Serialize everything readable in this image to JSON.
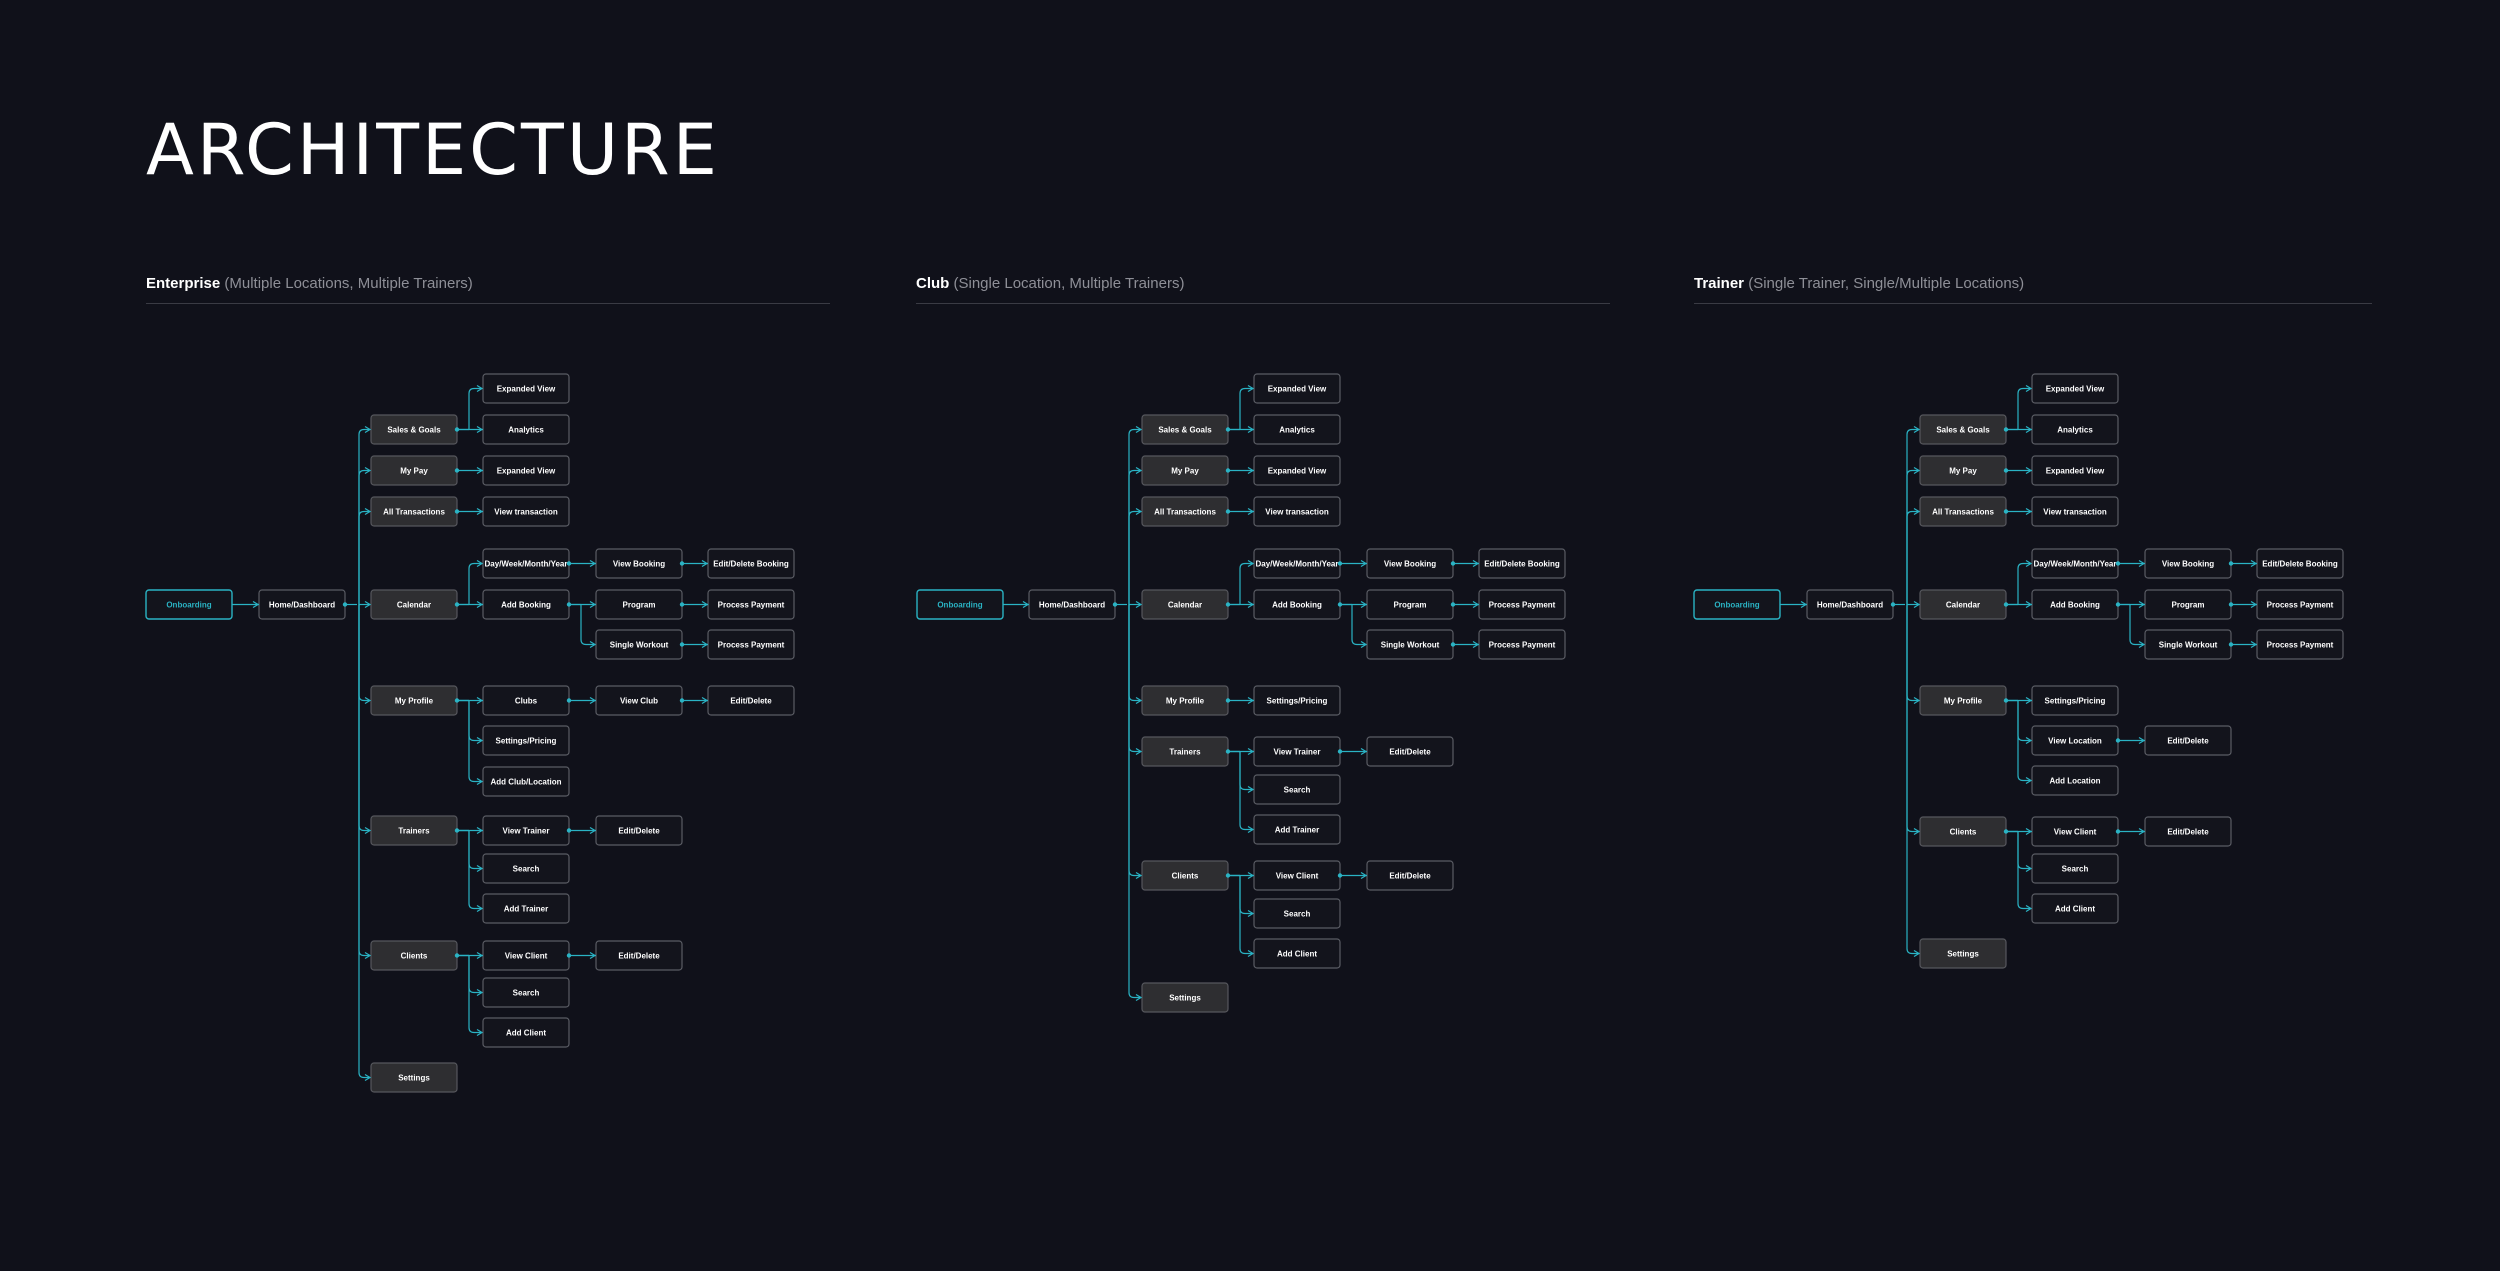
{
  "title": "ARCHITECTURE",
  "colors": {
    "background": "#10111a",
    "accent": "#2ab3c4",
    "category_fill": "#2e2e31",
    "box_border": "#5a5c64",
    "subtitle_gray": "#8e8f97"
  },
  "sections": [
    {
      "heading": "Enterprise",
      "subheading": "(Multiple Locations, Multiple Trainers)",
      "nodes": {
        "onboarding": "Onboarding",
        "home": "Home/Dashboard",
        "sales": "Sales & Goals",
        "sales_exp": "Expanded View",
        "sales_an": "Analytics",
        "mypay": "My Pay",
        "mypay_exp": "Expanded View",
        "alltx": "All Transactions",
        "alltx_view": "View transaction",
        "cal": "Calendar",
        "cal_day": "Day/Week/Month/Year",
        "cal_viewb": "View Booking",
        "cal_edb": "Edit/Delete Booking",
        "cal_add": "Add Booking",
        "cal_prog": "Program",
        "cal_pp1": "Process Payment",
        "cal_single": "Single Workout",
        "cal_pp2": "Process Payment",
        "prof": "My Profile",
        "prof_clubs": "Clubs",
        "prof_viewclub": "View Club",
        "prof_ed": "Edit/Delete",
        "prof_set": "Settings/Pricing",
        "prof_add": "Add Club/Location",
        "tr": "Trainers",
        "tr_view": "View Trainer",
        "tr_ed": "Edit/Delete",
        "tr_search": "Search",
        "tr_add": "Add Trainer",
        "cl": "Clients",
        "cl_view": "View Client",
        "cl_ed": "Edit/Delete",
        "cl_search": "Search",
        "cl_add": "Add Client",
        "settings": "Settings"
      }
    },
    {
      "heading": "Club",
      "subheading": "(Single Location, Multiple Trainers)",
      "nodes": {
        "onboarding": "Onboarding",
        "home": "Home/Dashboard",
        "sales": "Sales & Goals",
        "sales_exp": "Expanded View",
        "sales_an": "Analytics",
        "mypay": "My Pay",
        "mypay_exp": "Expanded View",
        "alltx": "All Transactions",
        "alltx_view": "View transaction",
        "cal": "Calendar",
        "cal_day": "Day/Week/Month/Year",
        "cal_viewb": "View Booking",
        "cal_edb": "Edit/Delete Booking",
        "cal_add": "Add Booking",
        "cal_prog": "Program",
        "cal_pp1": "Process Payment",
        "cal_single": "Single Workout",
        "cal_pp2": "Process Payment",
        "prof": "My Profile",
        "prof_set": "Settings/Pricing",
        "tr": "Trainers",
        "tr_view": "View Trainer",
        "tr_ed": "Edit/Delete",
        "tr_search": "Search",
        "tr_add": "Add Trainer",
        "cl": "Clients",
        "cl_view": "View Client",
        "cl_ed": "Edit/Delete",
        "cl_search": "Search",
        "cl_add": "Add Client",
        "settings": "Settings"
      }
    },
    {
      "heading": "Trainer",
      "subheading": "(Single Trainer, Single/Multiple Locations)",
      "nodes": {
        "onboarding": "Onboarding",
        "home": "Home/Dashboard",
        "sales": "Sales & Goals",
        "sales_exp": "Expanded View",
        "sales_an": "Analytics",
        "mypay": "My Pay",
        "mypay_exp": "Expanded View",
        "alltx": "All Transactions",
        "alltx_view": "View transaction",
        "cal": "Calendar",
        "cal_day": "Day/Week/Month/Year",
        "cal_viewb": "View Booking",
        "cal_edb": "Edit/Delete Booking",
        "cal_add": "Add Booking",
        "cal_prog": "Program",
        "cal_pp1": "Process Payment",
        "cal_single": "Single Workout",
        "cal_pp2": "Process Payment",
        "prof": "My Profile",
        "prof_set": "Settings/Pricing",
        "prof_viewloc": "View Location",
        "prof_ed": "Edit/Delete",
        "prof_addloc": "Add Location",
        "cl": "Clients",
        "cl_view": "View Client",
        "cl_ed": "Edit/Delete",
        "cl_search": "Search",
        "cl_add": "Add Client",
        "settings": "Settings"
      }
    }
  ]
}
